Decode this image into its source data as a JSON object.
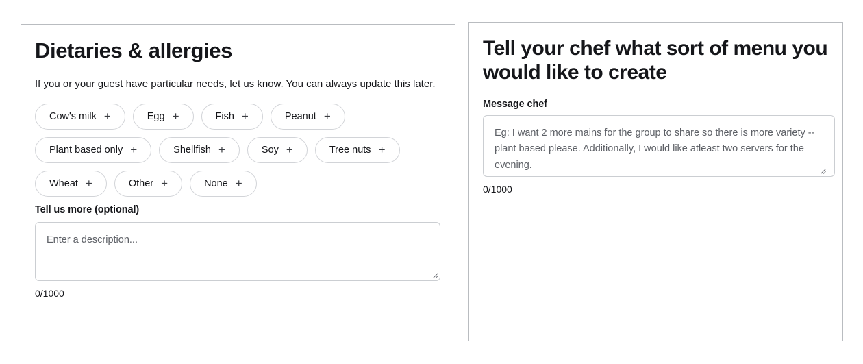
{
  "dietaries_panel": {
    "title": "Dietaries & allergies",
    "subtitle": "If you or your guest have particular needs, let us know. You can always update this later.",
    "chip_rows": [
      [
        {
          "label": "Cow's milk",
          "icon": "plus-icon",
          "glyph": "+"
        },
        {
          "label": "Egg",
          "icon": "plus-icon",
          "glyph": "+"
        },
        {
          "label": "Fish",
          "icon": "plus-icon",
          "glyph": "+"
        },
        {
          "label": "Peanut",
          "icon": "plus-icon",
          "glyph": "+"
        }
      ],
      [
        {
          "label": "Plant based only",
          "icon": "plus-icon",
          "glyph": "+"
        },
        {
          "label": "Shellfish",
          "icon": "plus-icon",
          "glyph": "+"
        },
        {
          "label": "Soy",
          "icon": "plus-icon",
          "glyph": "+"
        },
        {
          "label": "Tree nuts",
          "icon": "plus-icon",
          "glyph": "+"
        }
      ],
      [
        {
          "label": "Wheat",
          "icon": "plus-icon",
          "glyph": "+"
        },
        {
          "label": "Other",
          "icon": "plus-icon",
          "glyph": "+"
        },
        {
          "label": "None",
          "icon": "plus-icon",
          "glyph": "+"
        }
      ]
    ],
    "details_field": {
      "label": "Tell us more (optional)",
      "placeholder": "Enter a description...",
      "value": "",
      "counter": "0/1000"
    }
  },
  "chef_panel": {
    "title": "Tell your chef what sort of menu you would like to create",
    "message_field": {
      "label": "Message chef",
      "placeholder": "Eg: I want 2 more mains for the group to share so there is more variety -- plant based please. Additionally, I would like atleast two servers for the evening.",
      "value": "",
      "counter": "0/1000"
    }
  },
  "colors": {
    "text": "#15161a",
    "panel_border": "#b9bcc0",
    "chip_border": "#d2d4d8",
    "field_border": "#cbced2",
    "placeholder": "#5d6066",
    "background": "#ffffff"
  }
}
